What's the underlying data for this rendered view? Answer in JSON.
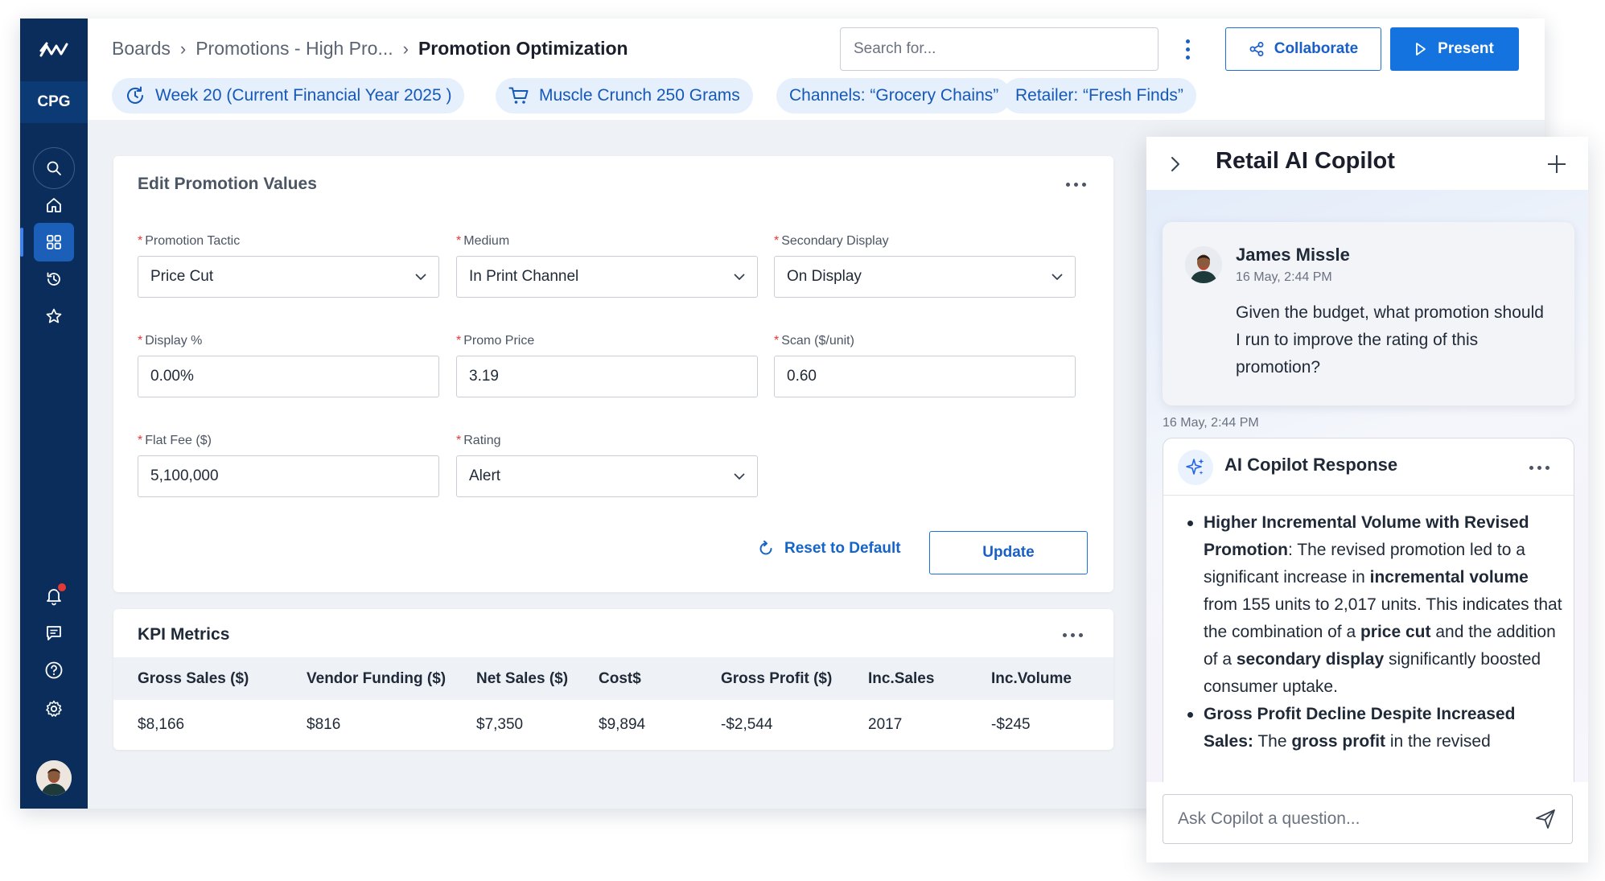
{
  "sidebar": {
    "org_label": "CPG",
    "nav": [
      "search-icon",
      "home-icon",
      "boards-icon",
      "history-icon",
      "favorites-icon",
      "bell-icon",
      "chat-icon",
      "help-icon",
      "settings-icon"
    ],
    "active": "boards-icon",
    "notification_dot": true
  },
  "header": {
    "breadcrumb": [
      "Boards",
      "Promotions - High Pro...",
      "Promotion Optimization"
    ],
    "search_placeholder": "Search for...",
    "collaborate_label": "Collaborate",
    "present_label": "Present",
    "chips": [
      {
        "icon": "calendar-refresh-icon",
        "label": "Week 20 (Current Financial Year 2025 )"
      },
      {
        "icon": "cart-icon",
        "label": "Muscle Crunch 250 Grams"
      },
      {
        "icon": "",
        "label": "Channels:  “Grocery Chains”"
      },
      {
        "icon": "",
        "label": "Retailer:  “Fresh Finds”"
      }
    ]
  },
  "edit": {
    "title": "Edit Promotion Values",
    "fields": {
      "promotion_tactic": {
        "label": "Promotion Tactic",
        "value": "Price Cut"
      },
      "medium": {
        "label": "Medium",
        "value": "In Print Channel"
      },
      "secondary_display": {
        "label": "Secondary Display",
        "value": "On Display"
      },
      "display_pct": {
        "label": "Display %",
        "value": "0.00%"
      },
      "promo_price": {
        "label": "Promo Price",
        "value": "3.19"
      },
      "scan": {
        "label": "Scan ($/unit)",
        "value": "0.60"
      },
      "flat_fee": {
        "label": "Flat Fee ($)",
        "value": "5,100,000"
      },
      "rating": {
        "label": "Rating",
        "value": "Alert"
      }
    },
    "reset_label": "Reset to Default",
    "update_label": "Update"
  },
  "kpi": {
    "title": "KPI Metrics",
    "columns": [
      "Gross Sales ($)",
      "Vendor Funding ($)",
      "Net Sales ($)",
      "Cost$",
      "Gross Profit ($)",
      "Inc.Sales",
      "Inc.Volume"
    ],
    "row": [
      "$8,166",
      "$816",
      "$7,350",
      "$9,894",
      "-$2,544",
      "2017",
      "-$245"
    ]
  },
  "copilot": {
    "title": "Retail AI Copilot",
    "user": {
      "name": "James Missle",
      "time": "16 May, 2:44 PM",
      "text": "Given the budget, what promotion should I run to improve the rating of this promotion?"
    },
    "response_time": "16 May, 2:44 PM",
    "response_title": "AI Copilot Response",
    "bullets": [
      {
        "head": "Higher Incremental Volume with Revised Promotion",
        "p1": ": The revised promotion led to a significant increase in ",
        "b1": "incremental volume",
        "p2": " from 155 units to 2,017 units. This indicates that the combination of a ",
        "b2": "price cut",
        "p3": " and the addition of a ",
        "b3": "secondary display",
        "p4": " significantly boosted consumer uptake."
      },
      {
        "head": "Gross Profit Decline Despite Increased Sales:",
        "p1": " The ",
        "b1": "gross profit",
        "p2": " in the revised"
      }
    ],
    "ask_placeholder": "Ask Copilot a question..."
  }
}
